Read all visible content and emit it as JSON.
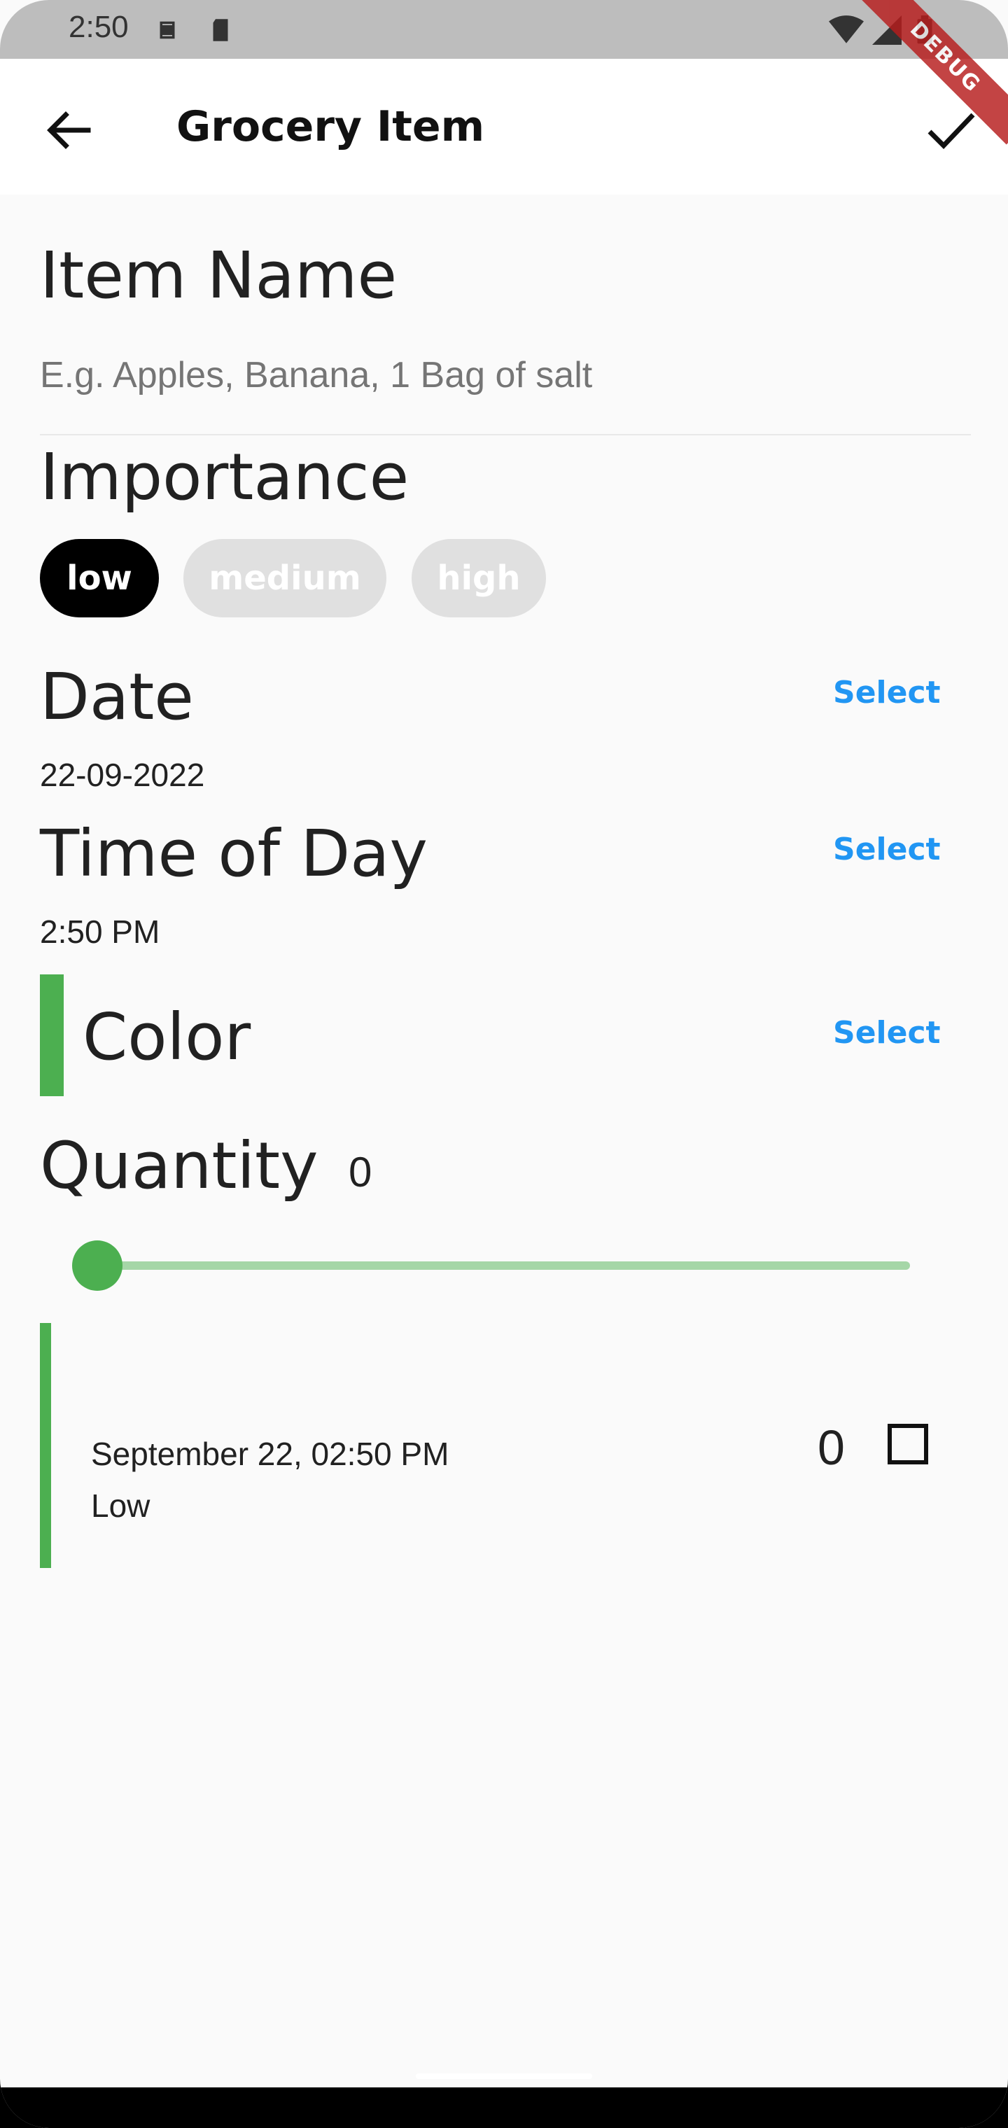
{
  "status_bar": {
    "time": "2:50",
    "icons": [
      "s-notification-icon",
      "sd-card-icon",
      "wifi-icon",
      "signal-icon",
      "battery-icon"
    ]
  },
  "app_bar": {
    "title": "Grocery Item",
    "back_icon": "arrow-back-icon",
    "save_icon": "check-icon"
  },
  "debug_banner": "DEBUG",
  "item_name": {
    "heading": "Item Name",
    "placeholder": "E.g. Apples, Banana, 1 Bag of salt"
  },
  "importance": {
    "heading": "Importance",
    "options": [
      "low",
      "medium",
      "high"
    ],
    "selected": "low"
  },
  "date": {
    "heading": "Date",
    "select_label": "Select",
    "value": "22-09-2022"
  },
  "time_of_day": {
    "heading": "Time of Day",
    "select_label": "Select",
    "value": "2:50 PM"
  },
  "color": {
    "heading": "Color",
    "select_label": "Select",
    "value": "#4caf50"
  },
  "quantity": {
    "heading": "Quantity",
    "value": "0",
    "slider_fraction": 0
  },
  "preview": {
    "date_time": "September 22, 02:50 PM",
    "importance": "Low",
    "quantity": "0",
    "checked": false,
    "accent": "#4caf50"
  },
  "colors": {
    "accent_blue": "#2196f3",
    "green": "#4caf50",
    "light_green": "#a5d6a7",
    "chip_inactive": "#e0e0e0"
  }
}
